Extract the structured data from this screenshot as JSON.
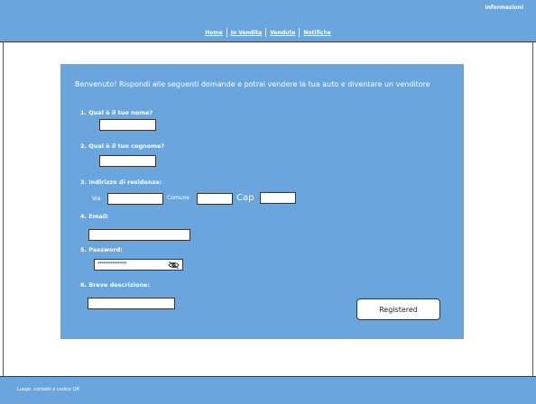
{
  "header": {
    "info_link": "Informazioni",
    "nav": [
      "Home",
      "In Vendita",
      "Vendute",
      "Notifiche"
    ]
  },
  "form": {
    "welcome": "Benvenuto! Rispondi alle seguenti domande e potrai vendere la tua auto e diventare un venditore",
    "q1": "1. Qual è il tuo nome?",
    "q2": "2. Qual è il tuo cognome?",
    "q3": "3. Indirizzo di residenza:",
    "via_label": "Via",
    "comune_label": "Comune",
    "cap_label": "Cap",
    "q4": "4. Email:",
    "q5": "5.  Password:",
    "password_value": "****************",
    "q6": "6.  Breve descrizione:",
    "submit_label": "Registered"
  },
  "icons": {
    "password_toggle": "eye-slash-icon"
  },
  "footer": {
    "text": "Luogo, contatti e codice QR"
  },
  "colors": {
    "primary": "#6aa6dd",
    "input_bg": "#ffffff"
  }
}
